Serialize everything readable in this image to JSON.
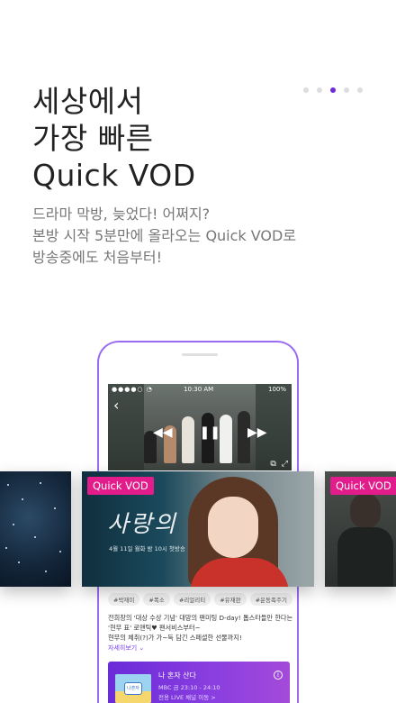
{
  "headline": [
    "세상에서",
    "가장 빠른",
    "Quick VOD"
  ],
  "subtext": [
    "드라마 막방, 늦었다! 어쩌지?",
    "본방 시작 5분만에 올라오는 Quick VOD로",
    "방송중에도 처음부터!"
  ],
  "pagination": {
    "count": 5,
    "active": 3
  },
  "player": {
    "status_time": "10:30 AM",
    "status_battery": "100%",
    "status_dots": "●●●●○ ◔",
    "back_icon": "‹",
    "controls": [
      "◀◀",
      "❚❚",
      "▶▶"
    ],
    "tools": [
      "⧉",
      "⤢"
    ]
  },
  "tags": [
    "#박재미",
    "#폭소",
    "#리얼리티",
    "#유재판",
    "#운동족주기"
  ],
  "description": [
    "전희창의 '대상 수상 기념' 대망의 팬미팅 D-day! 톱스타들만 한다는",
    "'현무 표' 로맨틱♥ 팬서비스부터~",
    "현무의 체취(?)가 가~득 담긴 스페셜한 선물까지!"
  ],
  "more_link": "자세히보기 ⌄",
  "live": {
    "badge": "나혼자",
    "title": "나 혼자 산다",
    "time": "MBC 금 23:10 - 24:10",
    "cta": "전용 LIVE 채널 이동 >",
    "info": "i"
  },
  "carousel": {
    "badge": "Quick VOD",
    "center_title": "사랑의 온도",
    "center_subtitle": "4월 11일 월화 밤 10시 첫방송"
  }
}
